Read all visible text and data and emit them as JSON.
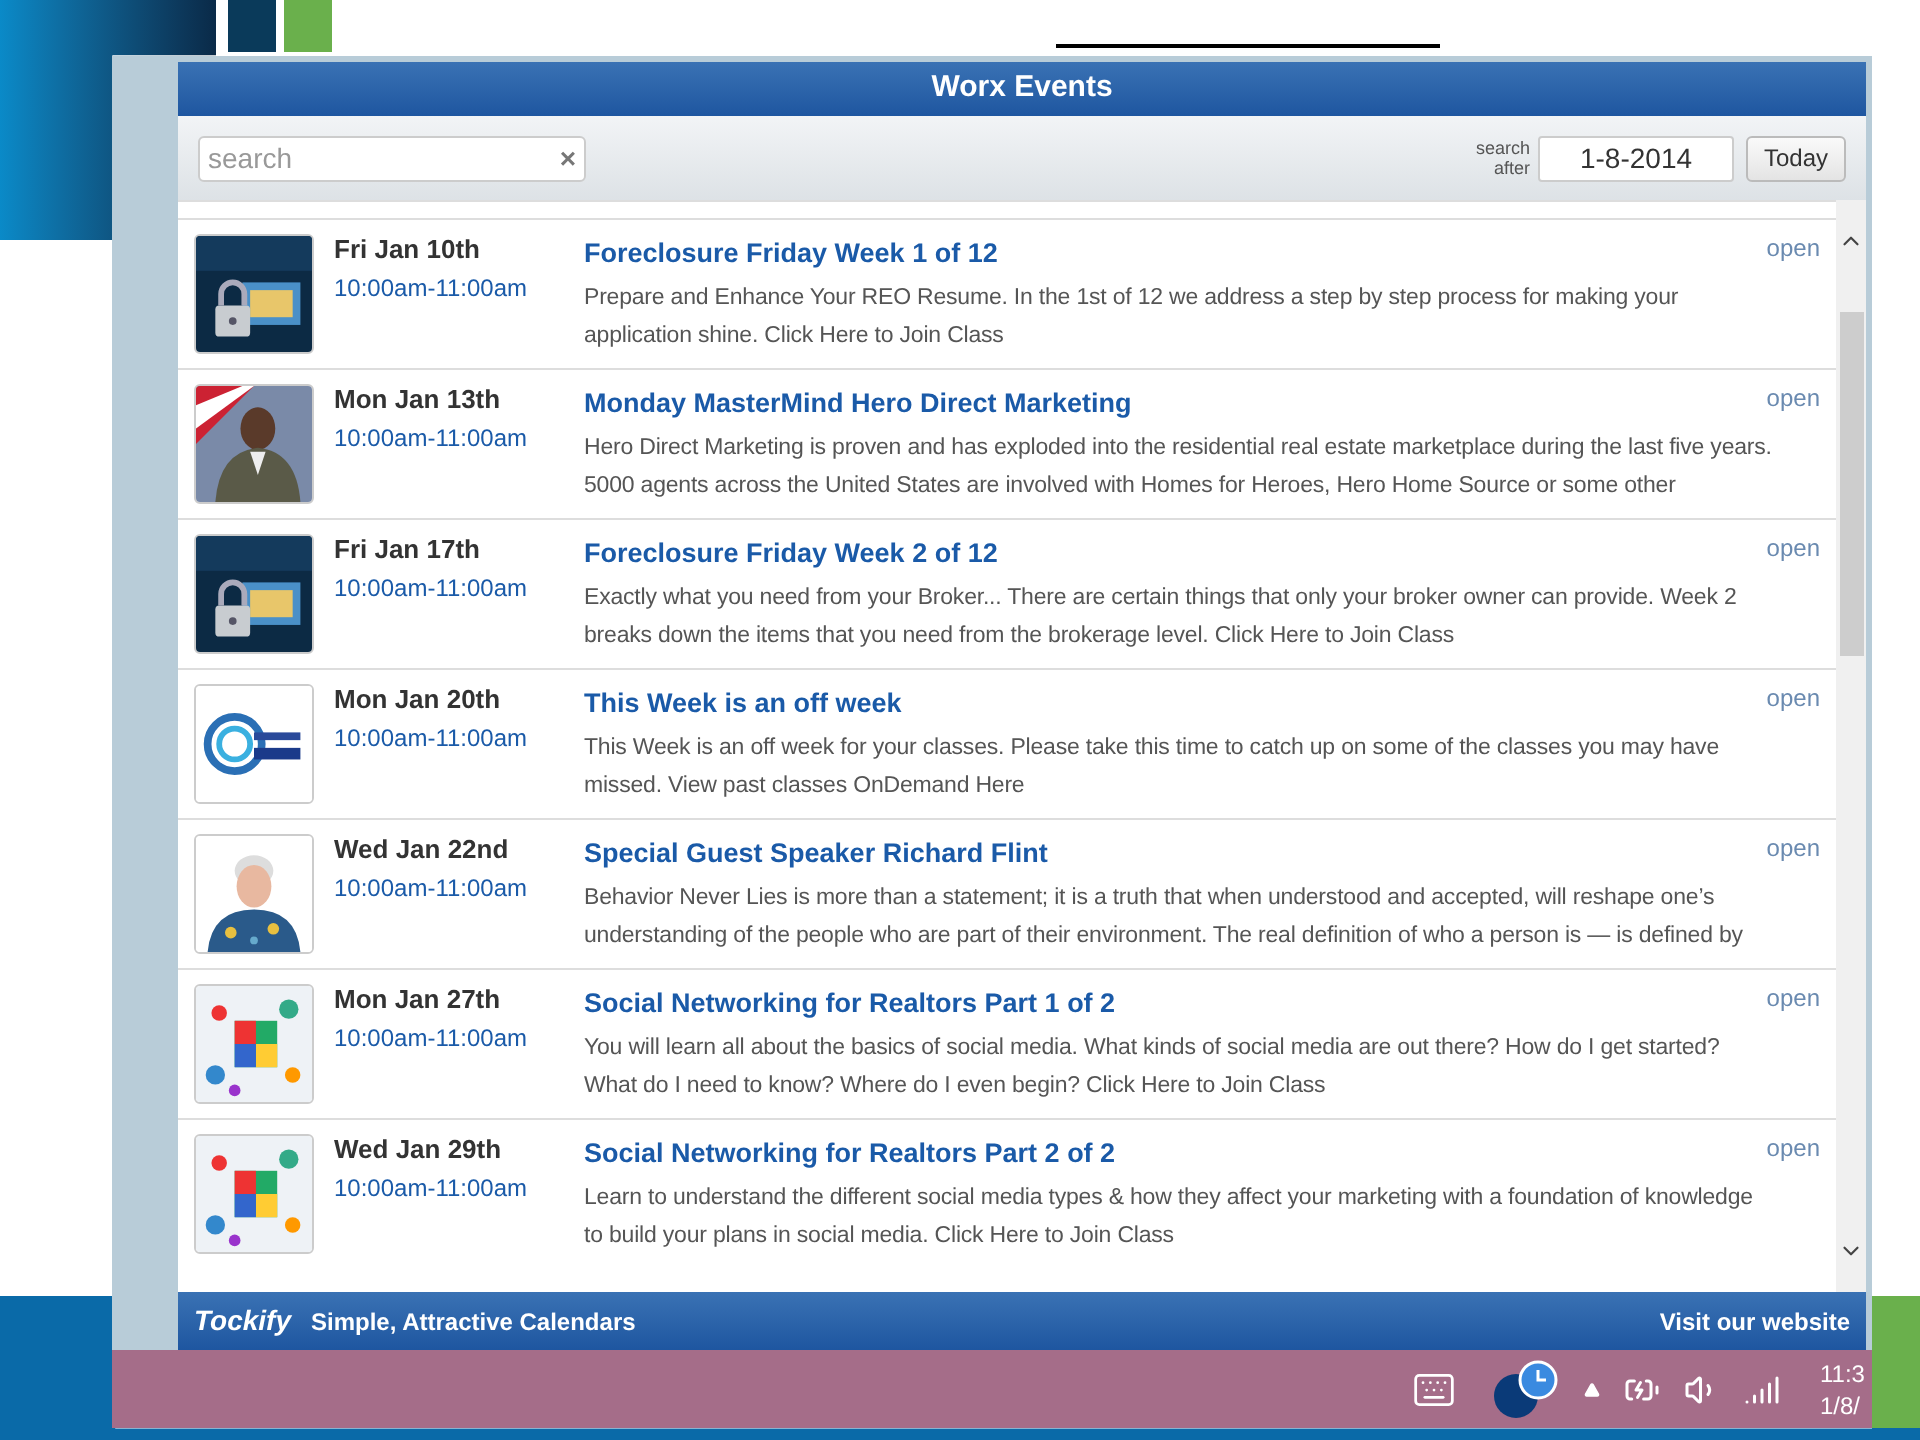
{
  "window": {
    "title": "Worx Events"
  },
  "toolbar": {
    "search": {
      "placeholder": "search",
      "clear": "×"
    },
    "date_label": "search after",
    "date": "1-8-2014",
    "today": "Today"
  },
  "events": [
    {
      "date": "Fri Jan 10th",
      "time": "10:00am-11:00am",
      "title": "Foreclosure Friday Week 1 of 12",
      "description": "Prepare and Enhance Your REO Resume. In the 1st of 12 we address a step by step process for making your application shine. Click Here to Join Class",
      "status": "open"
    },
    {
      "date": "Mon Jan 13th",
      "time": "10:00am-11:00am",
      "title": "Monday MasterMind Hero Direct Marketing",
      "description": "Hero Direct Marketing is proven and has exploded into the residential real estate marketplace during the last five years. 5000 agents across the United States are involved with Homes for Heroes, Hero Home Source or some other",
      "status": "open"
    },
    {
      "date": "Fri Jan 17th",
      "time": "10:00am-11:00am",
      "title": "Foreclosure Friday Week 2 of 12",
      "description": "Exactly what you need from your Broker... There are certain things that only your broker owner can provide. Week 2 breaks down the items that you need from the brokerage level. Click Here to Join Class",
      "status": "open"
    },
    {
      "date": "Mon Jan 20th",
      "time": "10:00am-11:00am",
      "title": "This Week is an off week",
      "description": "This Week is an off week for your classes. Please take this time to catch up on some of the classes you may have missed. View past classes OnDemand Here",
      "status": "open"
    },
    {
      "date": "Wed Jan 22nd",
      "time": "10:00am-11:00am",
      "title": "Special Guest Speaker Richard Flint",
      "description": "Behavior Never Lies is more than a statement; it is a truth that when understood and accepted, will reshape one’s understanding of the people who are part of their environment. The real definition of who a person is — is defined by",
      "status": "open"
    },
    {
      "date": "Mon Jan 27th",
      "time": "10:00am-11:00am",
      "title": "Social Networking for Realtors Part 1 of 2",
      "description": "You will learn all about the basics of social media. What kinds of social media are out there? How do I get started? What do I need to know? Where do I even begin? Click Here to Join Class",
      "status": "open"
    },
    {
      "date": "Wed Jan 29th",
      "time": "10:00am-11:00am",
      "title": "Social Networking for Realtors Part 2 of 2",
      "description": "Learn to understand the different social media types & how they affect your marketing with a foundation of knowledge to build your plans in social media. Click Here to Join Class",
      "status": "open"
    }
  ],
  "footer": {
    "brand": "Tockify",
    "tagline": "Simple, Attractive Calendars",
    "link": "Visit our website"
  },
  "taskbar": {
    "time": "11:3",
    "date": "1/8/"
  }
}
